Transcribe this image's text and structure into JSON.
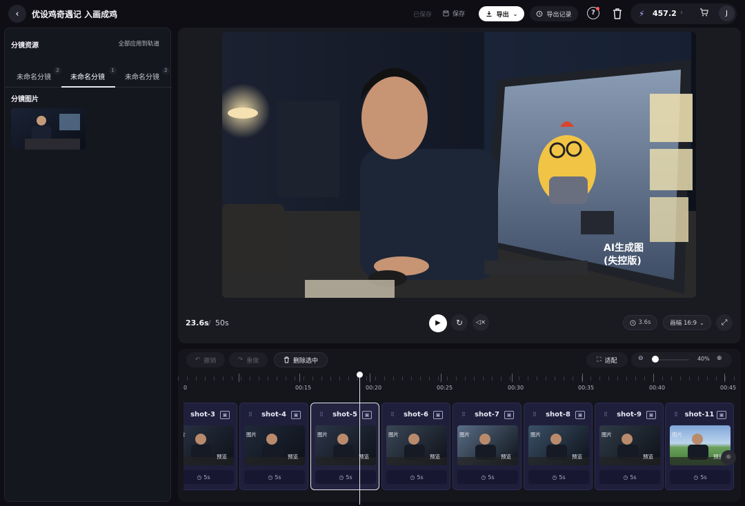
{
  "header": {
    "title": "优设鸡奇遇记 入画成鸡",
    "saved_label": "已保存",
    "save_label": "保存",
    "export_label": "导出",
    "history_label": "导出记录",
    "credits": "457.2",
    "avatar_initial": "J"
  },
  "left_panel": {
    "title": "分镜资源",
    "apply_all": "全部应用到轨道",
    "tabs": [
      {
        "label": "未命名分镜",
        "count": "2"
      },
      {
        "label": "未命名分镜",
        "count": "1",
        "active": true
      },
      {
        "label": "未命名分镜",
        "count": "2"
      }
    ],
    "images_title": "分镜图片"
  },
  "preview": {
    "overlay_line1": "AI生成图",
    "overlay_line2": "(失控版)",
    "current_time": "23.6s",
    "separator": "/",
    "total_time": "50s",
    "duration_badge": "3.6s",
    "ratio_badge": "画幅 16:9"
  },
  "timeline": {
    "undo_label": "撤销",
    "redo_label": "重做",
    "delete_label": "删除选中",
    "fit_label": "适配",
    "zoom_value": "40%",
    "zoom_fraction": 0.4,
    "ticks": [
      "0",
      "00:15",
      "00:20",
      "00:25",
      "00:30",
      "00:35",
      "00:40",
      "00:45"
    ],
    "clips": [
      {
        "name": "shot-3",
        "img_tag": "图片",
        "preview_tag": "预览",
        "duration": "5s"
      },
      {
        "name": "shot-4",
        "img_tag": "图片",
        "preview_tag": "预览",
        "duration": "5s"
      },
      {
        "name": "shot-5",
        "img_tag": "图片",
        "preview_tag": "预览",
        "duration": "5s",
        "selected": true
      },
      {
        "name": "shot-6",
        "img_tag": "图片",
        "preview_tag": "预览",
        "duration": "5s"
      },
      {
        "name": "shot-7",
        "img_tag": "图片",
        "preview_tag": "预览",
        "duration": "5s"
      },
      {
        "name": "shot-8",
        "img_tag": "图片",
        "preview_tag": "预览",
        "duration": "5s"
      },
      {
        "name": "shot-9",
        "img_tag": "图片",
        "preview_tag": "预览",
        "duration": "5s"
      },
      {
        "name": "shot-11",
        "img_tag": "图片",
        "preview_tag": "预览",
        "duration": "5s"
      }
    ]
  },
  "colors": {
    "background": "#0e0e14",
    "panel": "#15171f",
    "clip": "#1f1f3c",
    "accent": "#ffffff"
  }
}
